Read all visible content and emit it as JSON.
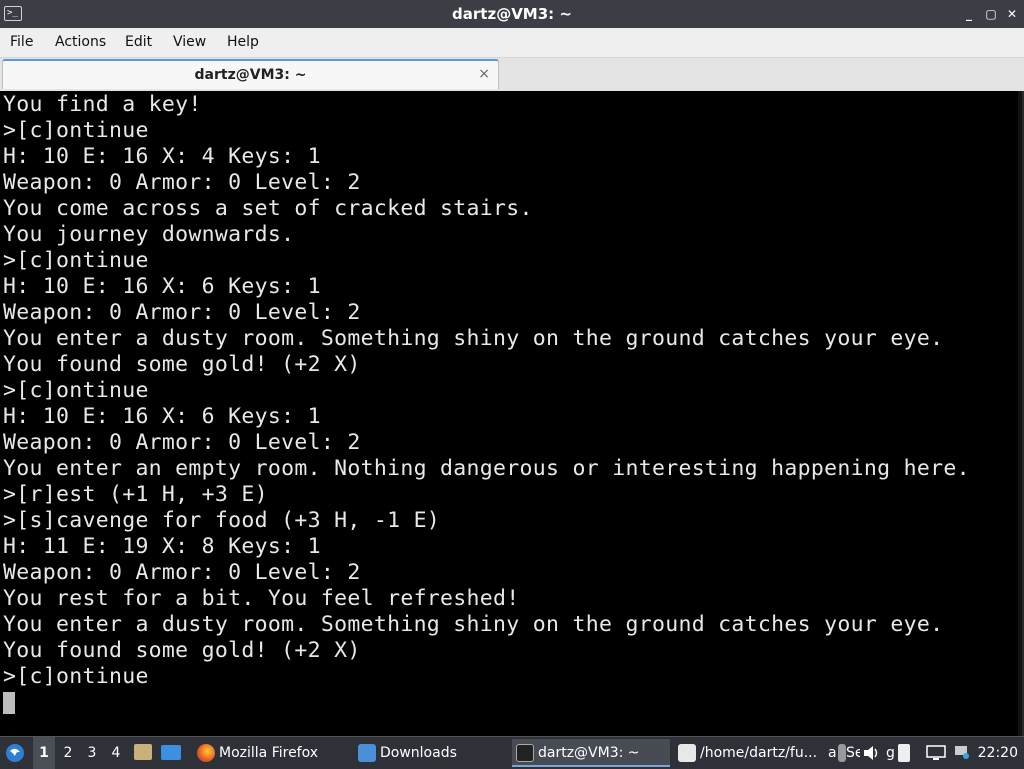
{
  "window": {
    "title": "dartz@VM3: ~",
    "terminal_icon": ">_",
    "minimize": "_",
    "maximize": "▢",
    "close": "✕"
  },
  "menu": {
    "file": "File",
    "actions": "Actions",
    "edit": "Edit",
    "view": "View",
    "help": "Help"
  },
  "tab": {
    "label": "dartz@VM3: ~",
    "close": "×"
  },
  "terminal": {
    "lines": [
      "You find a key!",
      ">[c]ontinue",
      "H: 10 E: 16 X: 4 Keys: 1",
      "Weapon: 0 Armor: 0 Level: 2",
      "You come across a set of cracked stairs.",
      "You journey downwards.",
      ">[c]ontinue",
      "H: 10 E: 16 X: 6 Keys: 1",
      "Weapon: 0 Armor: 0 Level: 2",
      "You enter a dusty room. Something shiny on the ground catches your eye.",
      "You found some gold! (+2 X)",
      ">[c]ontinue",
      "H: 10 E: 16 X: 6 Keys: 1",
      "Weapon: 0 Armor: 0 Level: 2",
      "You enter an empty room. Nothing dangerous or interesting happening here.",
      ">[r]est (+1 H, +3 E)",
      ">[s]cavenge for food (+3 H, -1 E)",
      "H: 11 E: 19 X: 8 Keys: 1",
      "Weapon: 0 Armor: 0 Level: 2",
      "You rest for a bit. You feel refreshed!",
      "You enter a dusty room. Something shiny on the ground catches your eye.",
      "You found some gold! (+2 X)",
      ">[c]ontinue"
    ]
  },
  "taskbar": {
    "workspaces": [
      "1",
      "2",
      "3",
      "4"
    ],
    "tasks": {
      "firefox": "Mozilla Firefox",
      "downloads": "Downloads",
      "terminal": "dartz@VM3: ~",
      "editor": "/home/dartz/fu...",
      "overflow1": "a",
      "overflow2": "Se",
      "overflow3": "g"
    },
    "clock": "22:20"
  },
  "colors": {
    "titlebar": "#3b3f45",
    "terminal_bg": "#000000",
    "terminal_fg": "#e8e8e8",
    "taskbar": "#2e3238",
    "accent": "#5b9bd5"
  }
}
